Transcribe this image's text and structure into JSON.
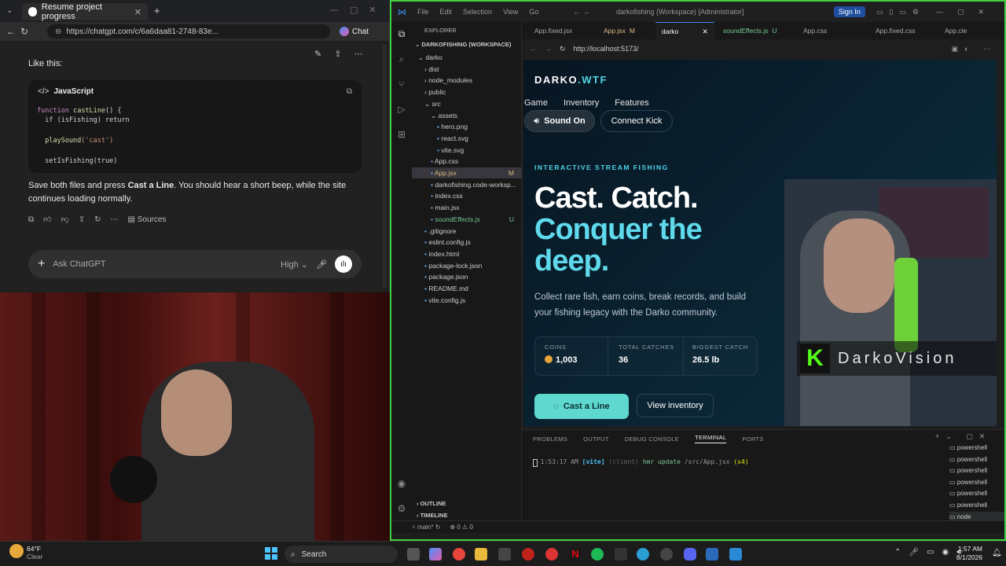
{
  "browser": {
    "tab_title": "Resume project progress",
    "url": "https://chatgpt.com/c/6a6daa81-2748-83e...",
    "chat_button": "Chat"
  },
  "chat": {
    "intro": "Like this:",
    "code_lang": "JavaScript",
    "code": {
      "l1_kw": "function",
      "l1_fn": "castLine",
      "l1_rest": "() {",
      "l2": "  if (isFishing) return",
      "l3_fn": "  playSound",
      "l3_str": "('cast')",
      "l4": "  setIsFishing(true)"
    },
    "para_a": "Save both files and press ",
    "para_b": "Cast a Line",
    "para_c": ". You should hear a short beep, while the site continues loading normally.",
    "sources": "Sources",
    "composer_placeholder": "Ask ChatGPT",
    "model": "High"
  },
  "vscode": {
    "title": "darkofishing (Workspace) [Administrator]",
    "menu": [
      "File",
      "Edit",
      "Selection",
      "View",
      "Go"
    ],
    "signin": "Sign In",
    "explorer_label": "EXPLORER",
    "workspace": "DARKOFISHING (WORKSPACE)",
    "tree": [
      {
        "name": "darko",
        "indent": 0,
        "kind": "folder-open"
      },
      {
        "name": "dist",
        "indent": 1,
        "kind": "folder"
      },
      {
        "name": "node_modules",
        "indent": 1,
        "kind": "folder"
      },
      {
        "name": "public",
        "indent": 1,
        "kind": "folder"
      },
      {
        "name": "src",
        "indent": 1,
        "kind": "folder-open"
      },
      {
        "name": "assets",
        "indent": 2,
        "kind": "folder-open"
      },
      {
        "name": "hero.png",
        "indent": 3,
        "kind": "file"
      },
      {
        "name": "react.svg",
        "indent": 3,
        "kind": "file"
      },
      {
        "name": "vite.svg",
        "indent": 3,
        "kind": "file"
      },
      {
        "name": "App.css",
        "indent": 2,
        "kind": "file"
      },
      {
        "name": "App.jsx",
        "indent": 2,
        "kind": "file",
        "badge": "M",
        "selected": true
      },
      {
        "name": "darkofishing.code-worksp...",
        "indent": 2,
        "kind": "file"
      },
      {
        "name": "index.css",
        "indent": 2,
        "kind": "file"
      },
      {
        "name": "main.jsx",
        "indent": 2,
        "kind": "file"
      },
      {
        "name": "soundEffects.js",
        "indent": 2,
        "kind": "file",
        "badge": "U"
      },
      {
        "name": ".gitignore",
        "indent": 1,
        "kind": "file"
      },
      {
        "name": "eslint.config.js",
        "indent": 1,
        "kind": "file"
      },
      {
        "name": "index.html",
        "indent": 1,
        "kind": "file"
      },
      {
        "name": "package-lock.json",
        "indent": 1,
        "kind": "file"
      },
      {
        "name": "package.json",
        "indent": 1,
        "kind": "file"
      },
      {
        "name": "README.md",
        "indent": 1,
        "kind": "file"
      },
      {
        "name": "vite.config.js",
        "indent": 1,
        "kind": "file"
      }
    ],
    "outline": "OUTLINE",
    "timeline": "TIMELINE",
    "tabs": [
      {
        "label": "App.fixed.jsx"
      },
      {
        "label": "App.jsx",
        "badge": "M"
      },
      {
        "label": "darko",
        "active": true
      },
      {
        "label": "soundEffects.js",
        "badge": "U"
      },
      {
        "label": "App.css"
      },
      {
        "label": "App.fixed.css"
      },
      {
        "label": "App.cle"
      }
    ],
    "preview_url": "http://localhost:5173/",
    "panel_tabs": [
      "PROBLEMS",
      "OUTPUT",
      "DEBUG CONSOLE",
      "TERMINAL",
      "PORTS"
    ],
    "terminal_line": {
      "time": "1:53:17 AM",
      "tag": "[vite]",
      "client": "(client)",
      "msg": "hmr update",
      "path": "/src/App.jsx",
      "count": "(x4)"
    },
    "terminals": [
      "powershell",
      "powershell",
      "powershell",
      "powershell",
      "powershell",
      "powershell",
      "node"
    ],
    "status": {
      "branch": "main*",
      "errors": "0",
      "warnings": "0"
    }
  },
  "site": {
    "logo_a": "DARKO",
    "logo_b": ".WTF",
    "nav": [
      "Game",
      "Inventory",
      "Features"
    ],
    "sound_btn": "Sound On",
    "connect_btn": "Connect Kick",
    "eyebrow": "INTERACTIVE STREAM FISHING",
    "hero_1": "Cast. Catch.",
    "hero_2": "Conquer the",
    "hero_3": "deep.",
    "lead": "Collect rare fish, earn coins, break records, and build your fishing legacy with the Darko community.",
    "stats": [
      {
        "label": "COINS",
        "value": "1,003"
      },
      {
        "label": "TOTAL CATCHES",
        "value": "36"
      },
      {
        "label": "BIGGEST CATCH",
        "value": "26.5 lb"
      }
    ],
    "cast_btn": "Cast a Line",
    "inventory_btn": "View inventory",
    "overlay_brand": "DarkoVision"
  },
  "taskbar": {
    "weather_temp": "64°F",
    "weather_desc": "Clear",
    "search": "Search",
    "time": "1:57 AM",
    "date": "8/1/2026"
  },
  "colors": {
    "accent": "#4fd6e6",
    "cta": "#5fd9d0",
    "kick_green": "#53fc18",
    "frame_green": "#3fd13f"
  }
}
